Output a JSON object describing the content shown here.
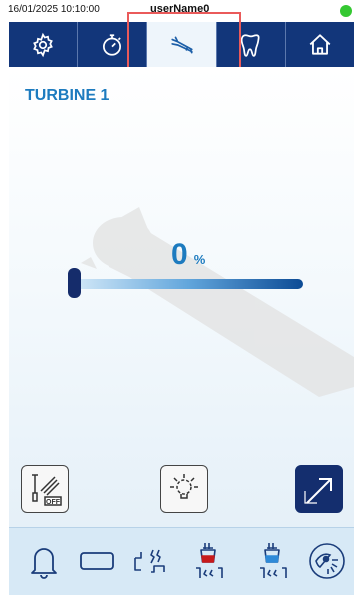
{
  "status": {
    "datetime": "16/01/2025 10:10:00",
    "user": "userName0",
    "connection_color": "#35c832"
  },
  "tabs": [
    {
      "name": "settings",
      "icon": "gear-icon",
      "active": false
    },
    {
      "name": "timer",
      "icon": "stopwatch-icon",
      "active": false
    },
    {
      "name": "instrument",
      "icon": "handpiece-icon",
      "active": true
    },
    {
      "name": "tooth",
      "icon": "tooth-icon",
      "active": false
    },
    {
      "name": "home",
      "icon": "home-icon",
      "active": false
    }
  ],
  "main": {
    "title": "TURBINE 1",
    "speed": {
      "value": "0",
      "unit": "%",
      "level_fraction": 0.0
    },
    "buttons": {
      "spray_off_icon": "spray-off-icon",
      "light_icon": "light-bulb-icon",
      "reverse_icon": "arrow-diagonal-icon"
    }
  },
  "bottom_bar": {
    "icons": [
      "bell-icon",
      "rectangle-icon",
      "water-dispense-icon",
      "cup-red-icon",
      "cup-blue-icon",
      "eye-sun-icon"
    ]
  },
  "colors": {
    "nav_bg": "#12367a",
    "accent": "#1d7bbf",
    "highlight": "#ea5a5a",
    "bottom_bg": "#d7e9f6"
  }
}
